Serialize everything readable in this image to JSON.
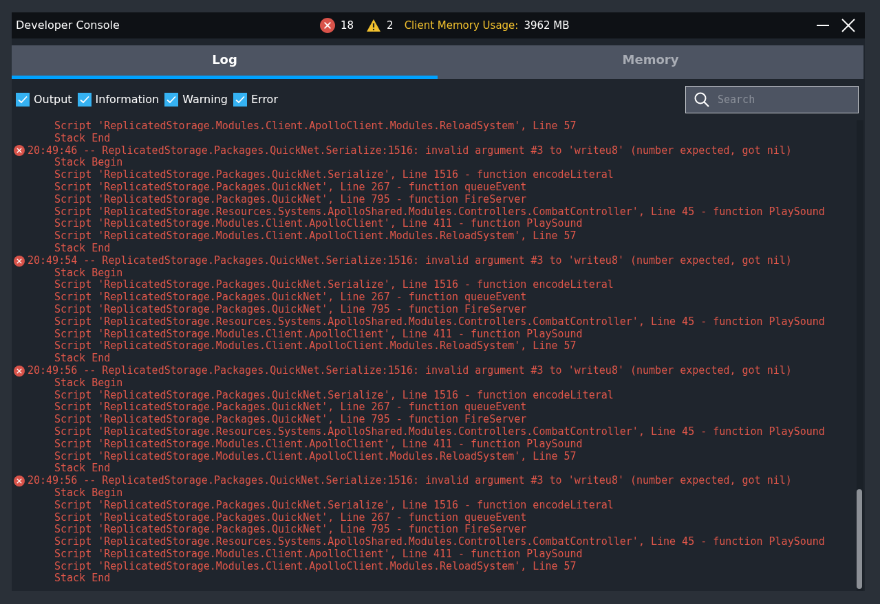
{
  "window": {
    "title": "Developer Console"
  },
  "status": {
    "errors": "18",
    "warnings": "2",
    "memory_label": "Client Memory Usage:",
    "memory_value": "3962 MB"
  },
  "tabs": [
    {
      "label": "Log",
      "selected": true
    },
    {
      "label": "Memory",
      "selected": false
    }
  ],
  "filters": [
    {
      "label": "Output",
      "checked": true
    },
    {
      "label": "Information",
      "checked": true
    },
    {
      "label": "Warning",
      "checked": true
    },
    {
      "label": "Error",
      "checked": true
    }
  ],
  "search": {
    "placeholder": "Search"
  },
  "log": [
    {
      "kind": "trace",
      "text": "Script 'ReplicatedStorage.Modules.Client.ApolloClient.Modules.ReloadSystem', Line 57"
    },
    {
      "kind": "trace",
      "text": "Stack End"
    },
    {
      "kind": "error",
      "text": "20:49:46 -- ReplicatedStorage.Packages.QuickNet.Serialize:1516: invalid argument #3 to 'writeu8' (number expected, got nil)"
    },
    {
      "kind": "trace",
      "text": "Stack Begin"
    },
    {
      "kind": "trace",
      "text": "Script 'ReplicatedStorage.Packages.QuickNet.Serialize', Line 1516 - function encodeLiteral"
    },
    {
      "kind": "trace",
      "text": "Script 'ReplicatedStorage.Packages.QuickNet', Line 267 - function queueEvent"
    },
    {
      "kind": "trace",
      "text": "Script 'ReplicatedStorage.Packages.QuickNet', Line 795 - function FireServer"
    },
    {
      "kind": "trace",
      "text": "Script 'ReplicatedStorage.Resources.Systems.ApolloShared.Modules.Controllers.CombatController', Line 45 - function PlaySound"
    },
    {
      "kind": "trace",
      "text": "Script 'ReplicatedStorage.Modules.Client.ApolloClient', Line 411 - function PlaySound"
    },
    {
      "kind": "trace",
      "text": "Script 'ReplicatedStorage.Modules.Client.ApolloClient.Modules.ReloadSystem', Line 57"
    },
    {
      "kind": "trace",
      "text": "Stack End"
    },
    {
      "kind": "error",
      "text": "20:49:54 -- ReplicatedStorage.Packages.QuickNet.Serialize:1516: invalid argument #3 to 'writeu8' (number expected, got nil)"
    },
    {
      "kind": "trace",
      "text": "Stack Begin"
    },
    {
      "kind": "trace",
      "text": "Script 'ReplicatedStorage.Packages.QuickNet.Serialize', Line 1516 - function encodeLiteral"
    },
    {
      "kind": "trace",
      "text": "Script 'ReplicatedStorage.Packages.QuickNet', Line 267 - function queueEvent"
    },
    {
      "kind": "trace",
      "text": "Script 'ReplicatedStorage.Packages.QuickNet', Line 795 - function FireServer"
    },
    {
      "kind": "trace",
      "text": "Script 'ReplicatedStorage.Resources.Systems.ApolloShared.Modules.Controllers.CombatController', Line 45 - function PlaySound"
    },
    {
      "kind": "trace",
      "text": "Script 'ReplicatedStorage.Modules.Client.ApolloClient', Line 411 - function PlaySound"
    },
    {
      "kind": "trace",
      "text": "Script 'ReplicatedStorage.Modules.Client.ApolloClient.Modules.ReloadSystem', Line 57"
    },
    {
      "kind": "trace",
      "text": "Stack End"
    },
    {
      "kind": "error",
      "text": "20:49:56 -- ReplicatedStorage.Packages.QuickNet.Serialize:1516: invalid argument #3 to 'writeu8' (number expected, got nil)"
    },
    {
      "kind": "trace",
      "text": "Stack Begin"
    },
    {
      "kind": "trace",
      "text": "Script 'ReplicatedStorage.Packages.QuickNet.Serialize', Line 1516 - function encodeLiteral"
    },
    {
      "kind": "trace",
      "text": "Script 'ReplicatedStorage.Packages.QuickNet', Line 267 - function queueEvent"
    },
    {
      "kind": "trace",
      "text": "Script 'ReplicatedStorage.Packages.QuickNet', Line 795 - function FireServer"
    },
    {
      "kind": "trace",
      "text": "Script 'ReplicatedStorage.Resources.Systems.ApolloShared.Modules.Controllers.CombatController', Line 45 - function PlaySound"
    },
    {
      "kind": "trace",
      "text": "Script 'ReplicatedStorage.Modules.Client.ApolloClient', Line 411 - function PlaySound"
    },
    {
      "kind": "trace",
      "text": "Script 'ReplicatedStorage.Modules.Client.ApolloClient.Modules.ReloadSystem', Line 57"
    },
    {
      "kind": "trace",
      "text": "Stack End"
    },
    {
      "kind": "error",
      "text": "20:49:56 -- ReplicatedStorage.Packages.QuickNet.Serialize:1516: invalid argument #3 to 'writeu8' (number expected, got nil)"
    },
    {
      "kind": "trace",
      "text": "Stack Begin"
    },
    {
      "kind": "trace",
      "text": "Script 'ReplicatedStorage.Packages.QuickNet.Serialize', Line 1516 - function encodeLiteral"
    },
    {
      "kind": "trace",
      "text": "Script 'ReplicatedStorage.Packages.QuickNet', Line 267 - function queueEvent"
    },
    {
      "kind": "trace",
      "text": "Script 'ReplicatedStorage.Packages.QuickNet', Line 795 - function FireServer"
    },
    {
      "kind": "trace",
      "text": "Script 'ReplicatedStorage.Resources.Systems.ApolloShared.Modules.Controllers.CombatController', Line 45 - function PlaySound"
    },
    {
      "kind": "trace",
      "text": "Script 'ReplicatedStorage.Modules.Client.ApolloClient', Line 411 - function PlaySound"
    },
    {
      "kind": "trace",
      "text": "Script 'ReplicatedStorage.Modules.Client.ApolloClient.Modules.ReloadSystem', Line 57"
    },
    {
      "kind": "trace",
      "text": "Stack End"
    }
  ]
}
